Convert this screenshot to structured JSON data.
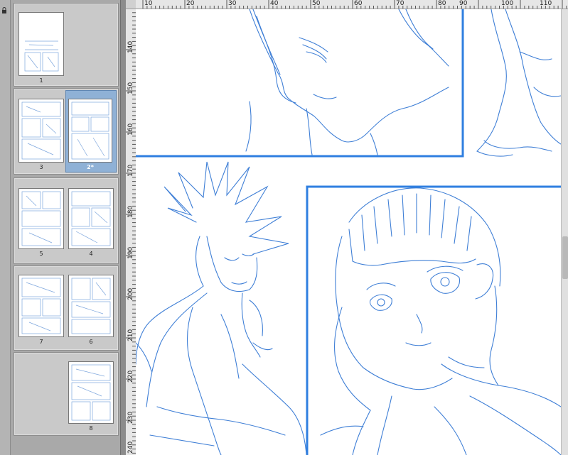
{
  "pages_panel": {
    "pages": [
      {
        "label": "1",
        "selected": false
      },
      {
        "label": "3",
        "selected": false
      },
      {
        "label": "2*",
        "selected": true
      },
      {
        "label": "5",
        "selected": false
      },
      {
        "label": "4",
        "selected": false
      },
      {
        "label": "7",
        "selected": false
      },
      {
        "label": "6",
        "selected": false
      },
      {
        "label": "8",
        "selected": false
      }
    ]
  },
  "rulers": {
    "horizontal": [
      "10",
      "20",
      "30",
      "40",
      "50",
      "60",
      "70",
      "80",
      "90",
      "100",
      "110"
    ],
    "vertical": [
      "140",
      "150",
      "160",
      "170",
      "180",
      "190",
      "200",
      "210",
      "220",
      "230",
      "240"
    ]
  },
  "colors": {
    "sketch": "#3f7fd6",
    "frame": "#2f7fe0",
    "selection": "#8fb1d6"
  },
  "icons": {
    "layer_lock": "lock-icon"
  }
}
